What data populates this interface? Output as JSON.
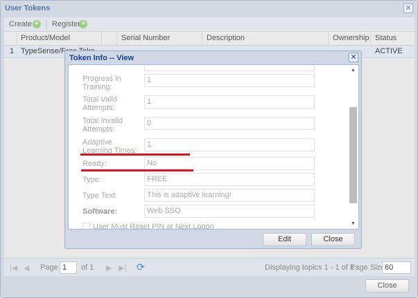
{
  "window": {
    "title": "User Tokens"
  },
  "toolbar": {
    "create": "Create",
    "register": "Register"
  },
  "grid": {
    "headers": [
      "Product/Model",
      "",
      "Serial Number",
      "Description",
      "Ownership",
      "Status"
    ],
    "rows": [
      {
        "num": "1",
        "product": "TypeSense/Free Toke",
        "status": "ACTIVE"
      }
    ]
  },
  "paging": {
    "page_label": "Page",
    "page": "1",
    "of": "of 1",
    "display": "Displaying topics 1 - 1 of 1",
    "page_size_label": "Page Size",
    "page_size": "60"
  },
  "close": "Close",
  "modal": {
    "title": "Token Info -- View",
    "fields": [
      {
        "label": "Progress in Training:",
        "value": "1"
      },
      {
        "label": "Total Valid Attempts:",
        "value": "1"
      },
      {
        "label": "Total Invalid Attempts:",
        "value": "0"
      },
      {
        "label": "Adaptive Learning Times:",
        "value": "1"
      },
      {
        "label": "Ready:",
        "value": "No"
      },
      {
        "label": "Type:",
        "value": "FREE"
      },
      {
        "label": "Type Text:",
        "value": "This is adaptive learning!"
      },
      {
        "label": "Software:",
        "value": "Web SSO"
      }
    ],
    "checkbox": "User Must Reset PIN at Next Logon",
    "edit": "Edit",
    "close": "Close"
  },
  "colors": {
    "highlight": "#e8101e",
    "title": "#15428b"
  }
}
